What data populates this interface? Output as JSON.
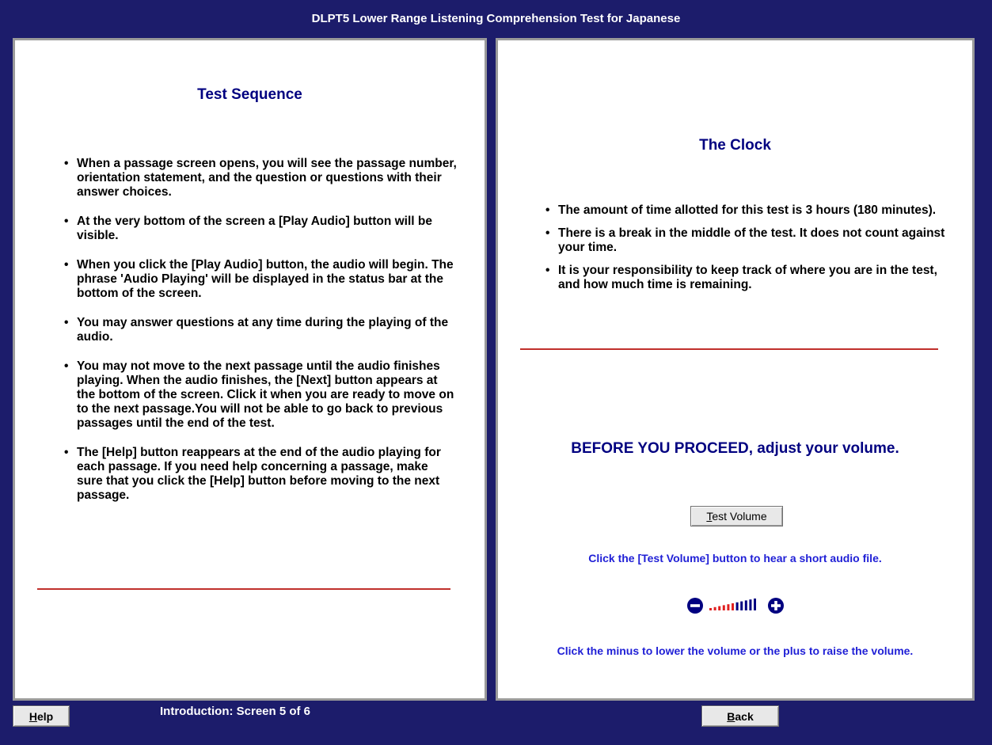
{
  "window": {
    "title": "DLPT5 Lower Range Listening Comprehension Test for Japanese"
  },
  "left_panel": {
    "heading": "Test Sequence",
    "bullets": [
      "When a passage screen opens, you will see the passage number, orientation statement, and the question or questions with their answer choices.",
      "At the very bottom of the screen a [Play Audio] button will be visible.",
      "When you click the [Play Audio] button, the audio will begin. The phrase 'Audio Playing' will be displayed in the status bar at the bottom of the screen.",
      "You may answer questions at any time during the playing of the audio.",
      "You may not move to the next passage until the audio finishes playing. When the audio finishes, the [Next] button appears at the bottom of the screen. Click it when you are ready to move on to the next passage.You will not be able to go back to previous passages until the end of the test.",
      "The [Help] button reappears at the end of the audio playing for each passage. If you need help concerning a passage, make sure that you click the [Help] button before moving to the next passage."
    ]
  },
  "right_panel": {
    "heading": "The Clock",
    "bullets": [
      "The amount of time allotted for this test is 3 hours (180 minutes).",
      "There is a break in the middle of the test. It does not count against your time.",
      "It is your responsibility to keep track of where you are in the test, and how much time is remaining."
    ],
    "proceed_text": "BEFORE YOU PROCEED, adjust your volume.",
    "test_volume_label": "Test Volume",
    "test_volume_note": "Click the [Test Volume] button to hear a short audio file.",
    "volume_note": "Click the minus to lower the volume or the plus to raise the volume.",
    "volume_level_fraction": 0.55,
    "volume_icons": {
      "minus": "minus-circle-icon",
      "plus": "plus-circle-icon"
    }
  },
  "footer": {
    "help_label": "Help",
    "status_text": "Introduction: Screen 5 of 6",
    "back_label": "Back"
  },
  "colors": {
    "frame_background": "#1c1c6b",
    "heading": "#000080",
    "note": "#1f1fd6",
    "rule": "#c0302c",
    "volume_low": "#e02020",
    "volume_high": "#000080"
  }
}
